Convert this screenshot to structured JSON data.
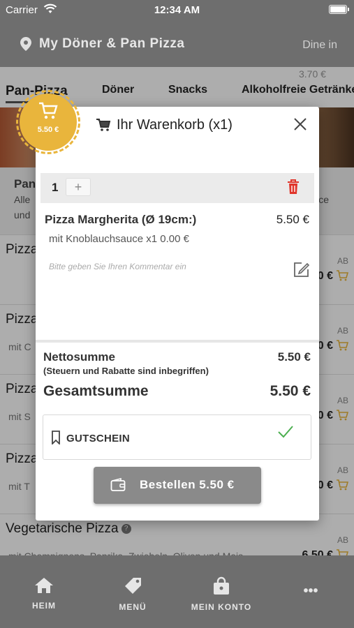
{
  "status_bar": {
    "carrier": "Carrier",
    "time": "12:34 AM"
  },
  "header": {
    "title": "My Döner & Pan Pizza",
    "mode": "Dine in"
  },
  "background": {
    "ghost_price": "3.70 €",
    "tabs": [
      "Pan-Pizza",
      "Döner",
      "Snacks",
      "Alkoholfreie Getränke"
    ],
    "category": {
      "title": "Pan",
      "line1": "Alle",
      "line2": "und",
      "line3_right": "ce"
    },
    "products": [
      {
        "name": "Pizza",
        "desc": "",
        "ab": "AB",
        "price": "0 €"
      },
      {
        "name": "Pizza",
        "desc": "mit C",
        "ab": "AB",
        "price": "0 €"
      },
      {
        "name": "Pizza",
        "desc": "mit S",
        "ab": "AB",
        "price": "0 €"
      },
      {
        "name": "Pizza",
        "desc": "mit T",
        "ab": "AB",
        "price": "0 €"
      },
      {
        "name": "Vegetarische Pizza",
        "desc": "mit Champignons, Paprika, Zwiebeln, Oliven und Mais",
        "ab": "AB",
        "price": "6.50 €"
      }
    ]
  },
  "cart_badge": {
    "amount": "5.50 €"
  },
  "cart": {
    "title": "Ihr Warenkorb (x1)",
    "items": [
      {
        "quantity": "1",
        "plus_label": "+",
        "name": "Pizza Margherita (Ø 19cm:)",
        "price": "5.50 €",
        "extra": "mit Knoblauchsauce x1 0.00 €",
        "comment_placeholder": "Bitte geben Sie Ihren Kommentar ein"
      }
    ],
    "net_label": "Nettosumme",
    "net_value": "5.50 €",
    "net_note": "(Steuern und Rabatte sind inbegriffen)",
    "total_label": "Gesamtsumme",
    "total_value": "5.50 €",
    "voucher_label": "GUTSCHEIN",
    "order_label": "Bestellen 5.50 €"
  },
  "tabbar": {
    "items": [
      "HEIM",
      "MENÜ",
      "MEIN KONTO",
      "•••"
    ]
  },
  "colors": {
    "accent": "#e9b53c",
    "header": "#6e6e6e",
    "delete": "#e0352b",
    "check": "#4caf50",
    "order_button": "#8a8a8a"
  }
}
